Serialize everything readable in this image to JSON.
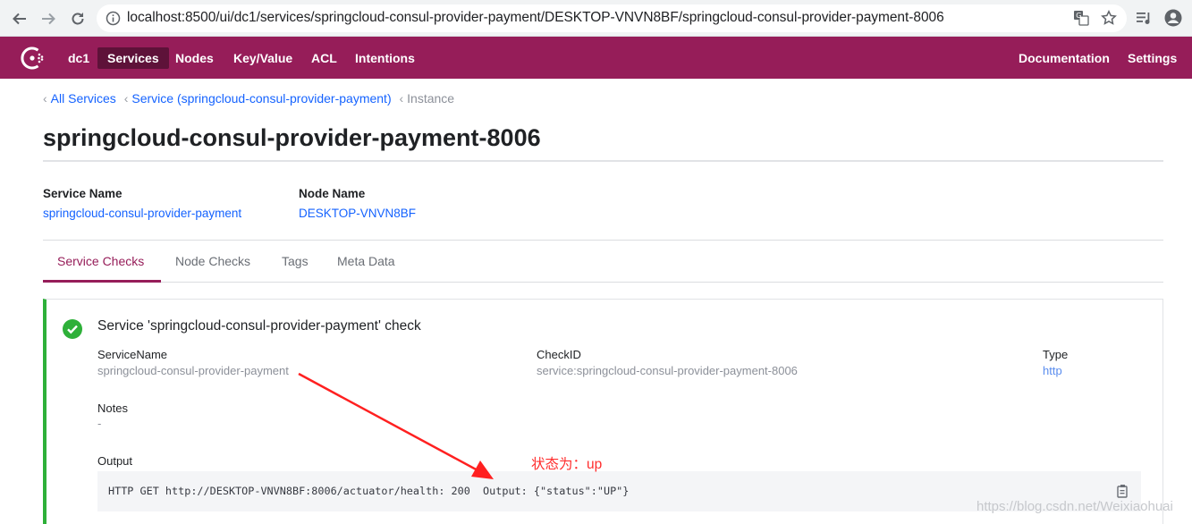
{
  "browser": {
    "url": "localhost:8500/ui/dc1/services/springcloud-consul-provider-payment/DESKTOP-VNVN8BF/springcloud-consul-provider-payment-8006",
    "back_icon": "arrow-left-icon",
    "forward_icon": "arrow-right-icon",
    "reload_icon": "reload-icon",
    "info_icon": "info-icon",
    "translate_icon": "translate-icon",
    "bookmark_icon": "star-icon",
    "media_icon": "media-queue-icon",
    "profile_icon": "account-icon"
  },
  "header": {
    "logo_icon": "consul-logo-icon",
    "brand_color": "#961d59",
    "datacenter": "dc1",
    "nav": [
      "Services",
      "Nodes",
      "Key/Value",
      "ACL",
      "Intentions"
    ],
    "active_nav": "Services",
    "right_nav": [
      "Documentation",
      "Settings"
    ]
  },
  "breadcrumbs": {
    "items": [
      "All Services",
      "Service (springcloud-consul-provider-payment)"
    ],
    "current": "Instance"
  },
  "page": {
    "title": "springcloud-consul-provider-payment-8006"
  },
  "details": {
    "service_name_label": "Service Name",
    "service_name_value": "springcloud-consul-provider-payment",
    "node_name_label": "Node Name",
    "node_name_value": "DESKTOP-VNVN8BF"
  },
  "tabs": {
    "items": [
      "Service Checks",
      "Node Checks",
      "Tags",
      "Meta Data"
    ],
    "active": "Service Checks"
  },
  "check": {
    "status_icon": "check-circle-icon",
    "status_color": "#2eb039",
    "title": "Service 'springcloud-consul-provider-payment' check",
    "service_name_label": "ServiceName",
    "service_name_value": "springcloud-consul-provider-payment",
    "check_id_label": "CheckID",
    "check_id_value": "service:springcloud-consul-provider-payment-8006",
    "type_label": "Type",
    "type_value": "http",
    "notes_label": "Notes",
    "notes_value": "-",
    "output_label": "Output",
    "output_value": "HTTP GET http://DESKTOP-VNVN8BF:8006/actuator/health: 200  Output: {\"status\":\"UP\"}",
    "copy_icon": "clipboard-copy-icon"
  },
  "annotation": {
    "text": "状态为：up",
    "color": "#ff2d2d"
  },
  "watermark": "https://blog.csdn.net/Weixiaohuai"
}
